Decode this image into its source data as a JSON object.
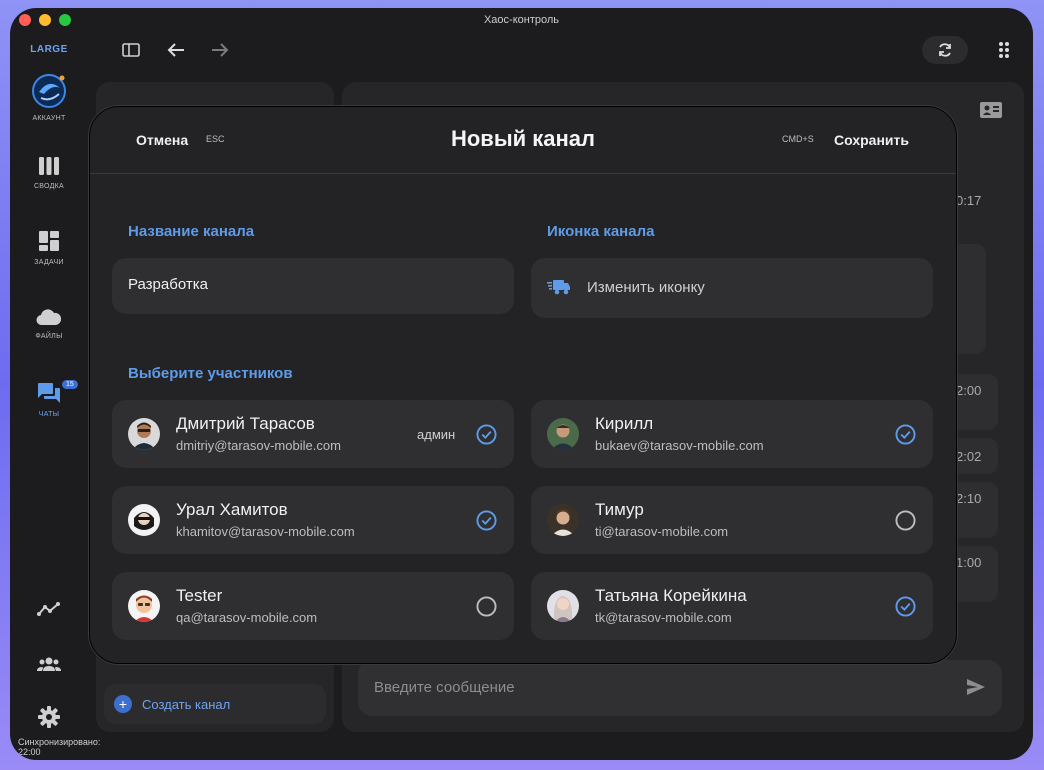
{
  "window": {
    "title": "Хаос-контроль"
  },
  "sidebar": {
    "brand": "LARGE",
    "items": [
      {
        "id": "account",
        "label": "АККАУНТ"
      },
      {
        "id": "summary",
        "label": "СВОДКА"
      },
      {
        "id": "tasks",
        "label": "ЗАДАЧИ"
      },
      {
        "id": "files",
        "label": "ФАЙЛЫ"
      },
      {
        "id": "chats",
        "label": "ЧАТЫ",
        "badge": "15"
      }
    ],
    "sync_status": "Синхронизировано: 22:00"
  },
  "chat_list": {
    "create_button": "Создать канал"
  },
  "chat": {
    "times": [
      "0:17",
      "2:00",
      "2:02",
      "2:10",
      "1:00"
    ],
    "input_placeholder": "Введите сообщение"
  },
  "modal": {
    "cancel": "Отмена",
    "cancel_shortcut": "ESC",
    "title": "Новый канал",
    "save_shortcut": "CMD+S",
    "save": "Сохранить",
    "name_label": "Название канала",
    "name_value": "Разработка",
    "icon_label": "Иконка канала",
    "icon_button": "Изменить иконку",
    "members_label": "Выберите участников",
    "members": [
      {
        "name": "Дмитрий Тарасов",
        "email": "dmitriy@tarasov-mobile.com",
        "role": "админ",
        "selected": true
      },
      {
        "name": "Кирилл",
        "email": "bukaev@tarasov-mobile.com",
        "role": "",
        "selected": true
      },
      {
        "name": "Урал Хамитов",
        "email": "khamitov@tarasov-mobile.com",
        "role": "",
        "selected": true
      },
      {
        "name": "Тимур",
        "email": "ti@tarasov-mobile.com",
        "role": "",
        "selected": false
      },
      {
        "name": "Tester",
        "email": "qa@tarasov-mobile.com",
        "role": "",
        "selected": false
      },
      {
        "name": "Татьяна Корейкина",
        "email": "tk@tarasov-mobile.com",
        "role": "",
        "selected": true
      }
    ]
  },
  "colors": {
    "accent": "#5e9be9",
    "background": "#1c1c1e",
    "card": "#2f2f31"
  }
}
